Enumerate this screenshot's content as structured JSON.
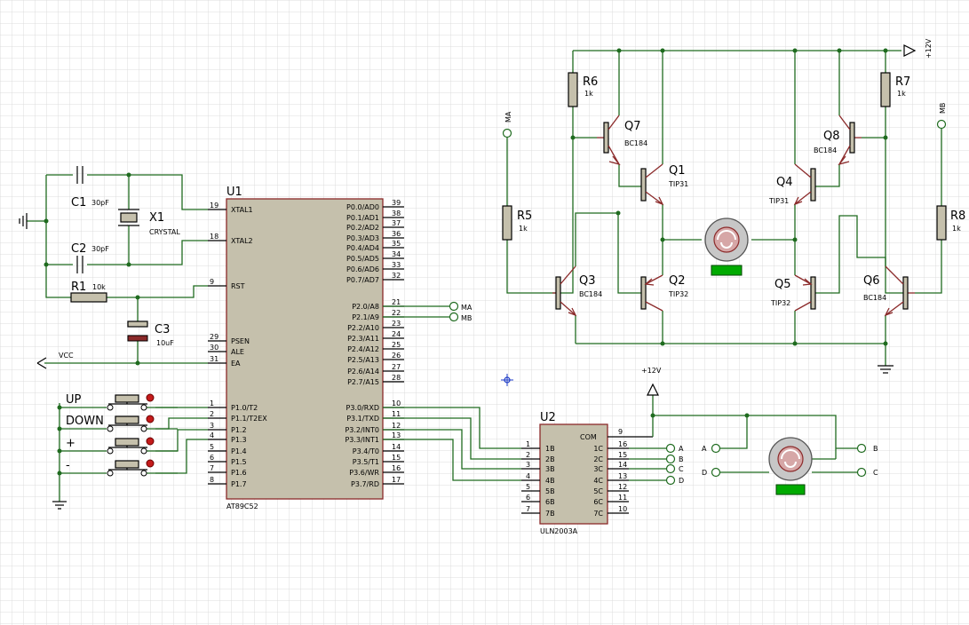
{
  "colors": {
    "wire": "#1f6b1f",
    "body": "#c5c0ac",
    "outline": "#8b2a2a",
    "grid": "#dcdcdc",
    "motor_label": "#00aa00"
  },
  "mcu": {
    "ref": "U1",
    "part": "AT89C52",
    "left_pins": [
      {
        "num": "19",
        "name": "XTAL1"
      },
      {
        "num": "18",
        "name": "XTAL2"
      },
      {
        "num": "9",
        "name": "RST"
      },
      {
        "num": "29",
        "name": "PSEN"
      },
      {
        "num": "30",
        "name": "ALE"
      },
      {
        "num": "31",
        "name": "EA"
      },
      {
        "num": "1",
        "name": "P1.0/T2"
      },
      {
        "num": "2",
        "name": "P1.1/T2EX"
      },
      {
        "num": "3",
        "name": "P1.2"
      },
      {
        "num": "4",
        "name": "P1.3"
      },
      {
        "num": "5",
        "name": "P1.4"
      },
      {
        "num": "6",
        "name": "P1.5"
      },
      {
        "num": "7",
        "name": "P1.6"
      },
      {
        "num": "8",
        "name": "P1.7"
      }
    ],
    "right_pins": [
      {
        "num": "39",
        "name": "P0.0/AD0"
      },
      {
        "num": "38",
        "name": "P0.1/AD1"
      },
      {
        "num": "37",
        "name": "P0.2/AD2"
      },
      {
        "num": "36",
        "name": "P0.3/AD3"
      },
      {
        "num": "35",
        "name": "P0.4/AD4"
      },
      {
        "num": "34",
        "name": "P0.5/AD5"
      },
      {
        "num": "33",
        "name": "P0.6/AD6"
      },
      {
        "num": "32",
        "name": "P0.7/AD7"
      },
      {
        "num": "21",
        "name": "P2.0/A8"
      },
      {
        "num": "22",
        "name": "P2.1/A9"
      },
      {
        "num": "23",
        "name": "P2.2/A10"
      },
      {
        "num": "24",
        "name": "P2.3/A11"
      },
      {
        "num": "25",
        "name": "P2.4/A12"
      },
      {
        "num": "26",
        "name": "P2.5/A13"
      },
      {
        "num": "27",
        "name": "P2.6/A14"
      },
      {
        "num": "28",
        "name": "P2.7/A15"
      },
      {
        "num": "10",
        "name": "P3.0/RXD"
      },
      {
        "num": "11",
        "name": "P3.1/TXD"
      },
      {
        "num": "12",
        "name": "P3.2/INT0"
      },
      {
        "num": "13",
        "name": "P3.3/INT1"
      },
      {
        "num": "14",
        "name": "P3.4/T0"
      },
      {
        "num": "15",
        "name": "P3.5/T1"
      },
      {
        "num": "16",
        "name": "P3.6/WR"
      },
      {
        "num": "17",
        "name": "P3.7/RD"
      }
    ]
  },
  "driver": {
    "ref": "U2",
    "part": "ULN2003A",
    "com": "COM",
    "com_pin": "9",
    "left_pins": [
      {
        "num": "1",
        "name": "1B"
      },
      {
        "num": "2",
        "name": "2B"
      },
      {
        "num": "3",
        "name": "3B"
      },
      {
        "num": "4",
        "name": "4B"
      },
      {
        "num": "5",
        "name": "5B"
      },
      {
        "num": "6",
        "name": "6B"
      },
      {
        "num": "7",
        "name": "7B"
      }
    ],
    "right_pins": [
      {
        "num": "16",
        "name": "1C"
      },
      {
        "num": "15",
        "name": "2C"
      },
      {
        "num": "14",
        "name": "3C"
      },
      {
        "num": "13",
        "name": "4C"
      },
      {
        "num": "12",
        "name": "5C"
      },
      {
        "num": "11",
        "name": "6C"
      },
      {
        "num": "10",
        "name": "7C"
      }
    ],
    "outputs": [
      "A",
      "B",
      "C",
      "D"
    ]
  },
  "passives": {
    "c1": {
      "ref": "C1",
      "value": "30pF"
    },
    "c2": {
      "ref": "C2",
      "value": "30pF"
    },
    "c3": {
      "ref": "C3",
      "value": "10uF"
    },
    "x1": {
      "ref": "X1",
      "value": "CRYSTAL"
    },
    "r1": {
      "ref": "R1",
      "value": "10k"
    },
    "r5": {
      "ref": "R5",
      "value": "1k"
    },
    "r6": {
      "ref": "R6",
      "value": "1k"
    },
    "r7": {
      "ref": "R7",
      "value": "1k"
    },
    "r8": {
      "ref": "R8",
      "value": "1k"
    }
  },
  "transistors": {
    "q1": {
      "ref": "Q1",
      "part": "TIP31"
    },
    "q2": {
      "ref": "Q2",
      "part": "TIP32"
    },
    "q3": {
      "ref": "Q3",
      "part": "BC184"
    },
    "q4": {
      "ref": "Q4",
      "part": "TIP31"
    },
    "q5": {
      "ref": "Q5",
      "part": "TIP32"
    },
    "q6": {
      "ref": "Q6",
      "part": "BC184"
    },
    "q7": {
      "ref": "Q7",
      "part": "BC184"
    },
    "q8": {
      "ref": "Q8",
      "part": "BC184"
    }
  },
  "buttons": [
    "UP",
    "DOWN",
    "+",
    "-"
  ],
  "nets": {
    "vcc": "VCC",
    "v12": "+12V",
    "ma": "MA",
    "mb": "MB",
    "a": "A",
    "b": "B",
    "c": "C",
    "d": "D"
  },
  "motors": {
    "m1_label": "",
    "m2_label": ""
  }
}
